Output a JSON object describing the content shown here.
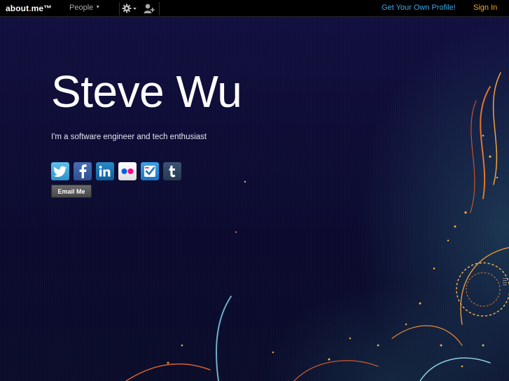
{
  "topbar": {
    "logo_text": "about",
    "logo_dot": ".",
    "logo_suffix": "me™",
    "people_label": "People",
    "get_profile_label": "Get Your Own Profile!",
    "signin_label": "Sign In"
  },
  "profile": {
    "name": "Steve Wu",
    "headline": "I'm a software engineer and tech enthusiast",
    "email_button": "Email Me"
  },
  "socials": [
    {
      "service": "twitter",
      "icon": "twitter-icon"
    },
    {
      "service": "facebook",
      "icon": "facebook-icon"
    },
    {
      "service": "linkedin",
      "icon": "linkedin-icon"
    },
    {
      "service": "flickr",
      "icon": "flickr-icon"
    },
    {
      "service": "foursquare",
      "icon": "foursquare-icon"
    },
    {
      "service": "tumblr",
      "icon": "tumblr-icon"
    }
  ],
  "colors": {
    "brand_orange": "#f5a623",
    "link_blue": "#3ea8e5",
    "background": "#0d0b33"
  }
}
